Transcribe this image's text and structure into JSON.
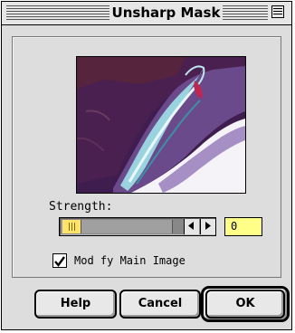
{
  "window": {
    "title": "Unsharp Mask"
  },
  "strength": {
    "label": "Strength:",
    "value": "0",
    "slider_level": 0
  },
  "options": {
    "modify_main_image_label": "Mod fy Main Image",
    "modify_main_image_checked": true
  },
  "buttons": {
    "help_label": "Help",
    "cancel_label": "Cancel",
    "ok_label": "OK"
  },
  "colors": {
    "dialog_background": "#dddddd",
    "slider_thumb": "#ffe36a",
    "value_field": "#ffff88",
    "preview_purple": "#5a2c6e"
  }
}
